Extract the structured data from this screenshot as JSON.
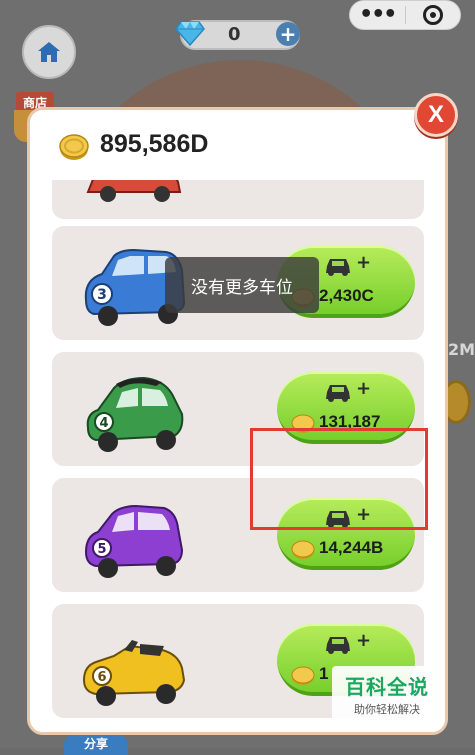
{
  "top_bar": {
    "gem_value": "0",
    "gem_plus": "+",
    "more_icon": "more-dots-icon",
    "close_mini_icon": "target-circle-icon"
  },
  "background": {
    "shop_label": "商店",
    "side_text": "2M"
  },
  "modal": {
    "balance": "895,586D",
    "close_label": "X"
  },
  "cars": [
    {
      "name": "car-level-2",
      "price": "",
      "color": "#d84a3a",
      "number": ""
    },
    {
      "name": "car-level-3",
      "price": "2,430C",
      "color": "#3a7bd5",
      "number": "3"
    },
    {
      "name": "car-level-4",
      "price": "131,187",
      "color": "#3a9b4a",
      "number": "4"
    },
    {
      "name": "car-level-5",
      "price": "14,244B",
      "color": "#8c3fd0",
      "number": "5"
    },
    {
      "name": "car-level-6",
      "price": "1",
      "color": "#f0c020",
      "number": "6"
    }
  ],
  "toast": {
    "message": "没有更多车位"
  },
  "buy_plus": "+",
  "watermark": {
    "main": "百科全说",
    "sub": "助你轻松解决"
  },
  "bottom_peek": "分享"
}
